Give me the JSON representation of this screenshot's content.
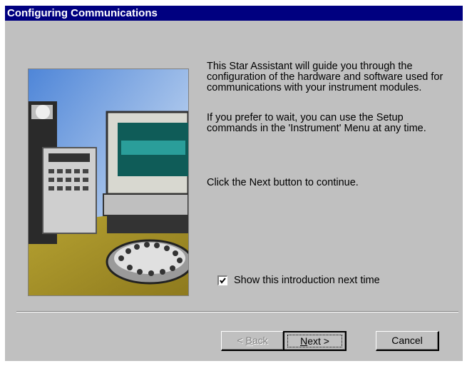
{
  "window": {
    "title": "Configuring Communications"
  },
  "intro": {
    "paragraph1": "This Star Assistant will guide you through the configuration of the hardware and software used for communications with your instrument modules.",
    "paragraph2": "If you prefer to wait, you can use the Setup commands in the 'Instrument' Menu at any time.",
    "paragraph3": "Click the Next button to continue."
  },
  "checkbox": {
    "label": "Show this introduction next time",
    "checked": true
  },
  "buttons": {
    "back": {
      "prefix": "< ",
      "mnemonic": "B",
      "rest": "ack"
    },
    "next": {
      "mnemonic": "N",
      "rest": "ext >"
    },
    "cancel": "Cancel"
  },
  "colors": {
    "titlebar": "#000080",
    "dialog": "#c0c0c0",
    "disabled_text": "#808080"
  }
}
